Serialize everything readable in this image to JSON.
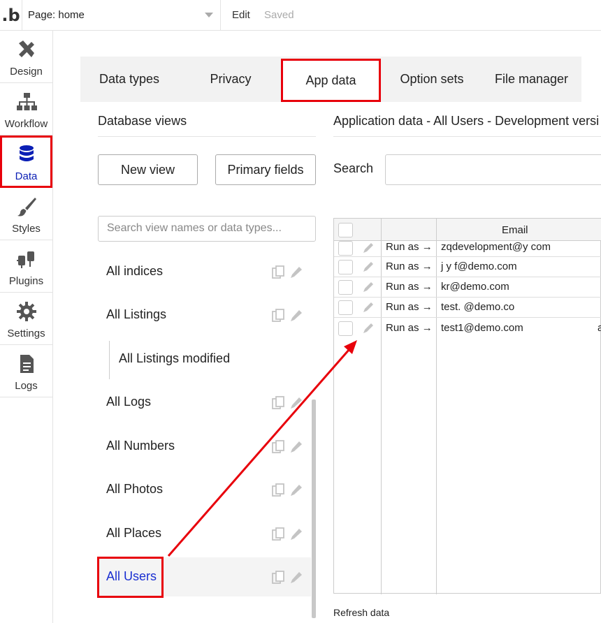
{
  "topbar": {
    "logo": ".b",
    "page_label": "Page: home",
    "edit": "Edit",
    "saved": "Saved"
  },
  "sidebar": {
    "items": [
      {
        "label": "Design",
        "icon": "design-icon"
      },
      {
        "label": "Workflow",
        "icon": "workflow-icon"
      },
      {
        "label": "Data",
        "icon": "database-icon",
        "active": true
      },
      {
        "label": "Styles",
        "icon": "brush-icon"
      },
      {
        "label": "Plugins",
        "icon": "plug-icon"
      },
      {
        "label": "Settings",
        "icon": "gear-icon"
      },
      {
        "label": "Logs",
        "icon": "document-icon"
      }
    ]
  },
  "tabs": [
    "Data types",
    "Privacy",
    "App data",
    "Option sets",
    "File manager"
  ],
  "database_views": {
    "title": "Database views",
    "new_view": "New view",
    "primary_fields": "Primary fields",
    "search_placeholder": "Search view names or data types...",
    "items": [
      "All indices",
      "All Listings",
      "All Listings modified",
      "All Logs",
      "All Numbers",
      "All Photos",
      "All Places",
      "All Users"
    ]
  },
  "app_data": {
    "title": "Application data - All Users - Development versi",
    "search_label": "Search",
    "email_header": "Email",
    "rows": [
      {
        "runas": "Run as →",
        "email": "zqdevelopment@y         com",
        "extra": ""
      },
      {
        "runas": "Run as →",
        "email": "j               y    f@demo.com",
        "extra": ""
      },
      {
        "runas": "Run as →",
        "email": "kr@demo.com",
        "extra": ""
      },
      {
        "runas": "Run as →",
        "email": "test.                        @demo.co",
        "extra": ""
      },
      {
        "runas": "Run as →",
        "email": "test1@demo.com",
        "extra": "a"
      }
    ],
    "refresh": "Refresh data"
  },
  "colors": {
    "highlight": "#e8000b",
    "active_text": "#0b1fb5"
  }
}
